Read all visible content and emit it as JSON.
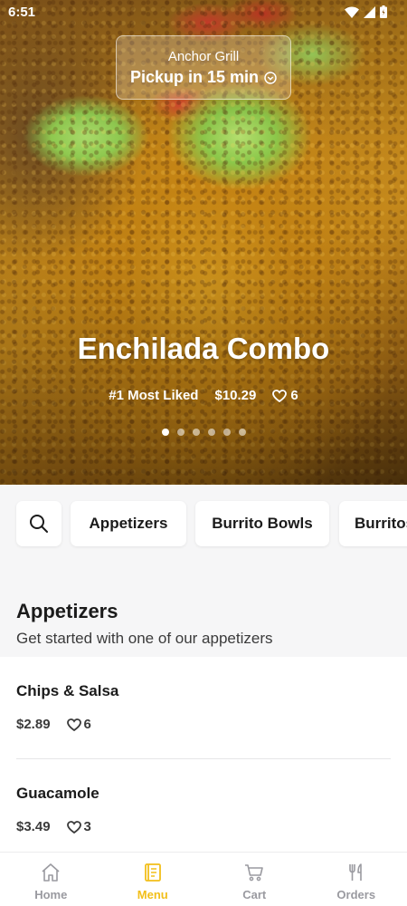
{
  "status_bar": {
    "time": "6:51"
  },
  "pickup": {
    "restaurant": "Anchor Grill",
    "eta": "Pickup in 15 min"
  },
  "hero": {
    "title": "Enchilada Combo",
    "rank": "#1 Most Liked",
    "price": "$10.29",
    "likes": "6",
    "carousel": {
      "count": 6,
      "active": 1
    }
  },
  "categories": [
    "Appetizers",
    "Burrito Bowls",
    "Burritos"
  ],
  "section": {
    "title": "Appetizers",
    "subtitle": "Get started with one of our appetizers"
  },
  "items": [
    {
      "name": "Chips & Salsa",
      "price": "$2.89",
      "likes": "6"
    },
    {
      "name": "Guacamole",
      "price": "$3.49",
      "likes": "3"
    }
  ],
  "nav": [
    {
      "label": "Home",
      "icon": "home-icon",
      "active": false
    },
    {
      "label": "Menu",
      "icon": "menu-book-icon",
      "active": true
    },
    {
      "label": "Cart",
      "icon": "cart-icon",
      "active": false
    },
    {
      "label": "Orders",
      "icon": "utensils-icon",
      "active": false
    }
  ],
  "colors": {
    "accent": "#f2bf1a",
    "inactive": "#9a9aa0",
    "text": "#1b1b1b"
  }
}
